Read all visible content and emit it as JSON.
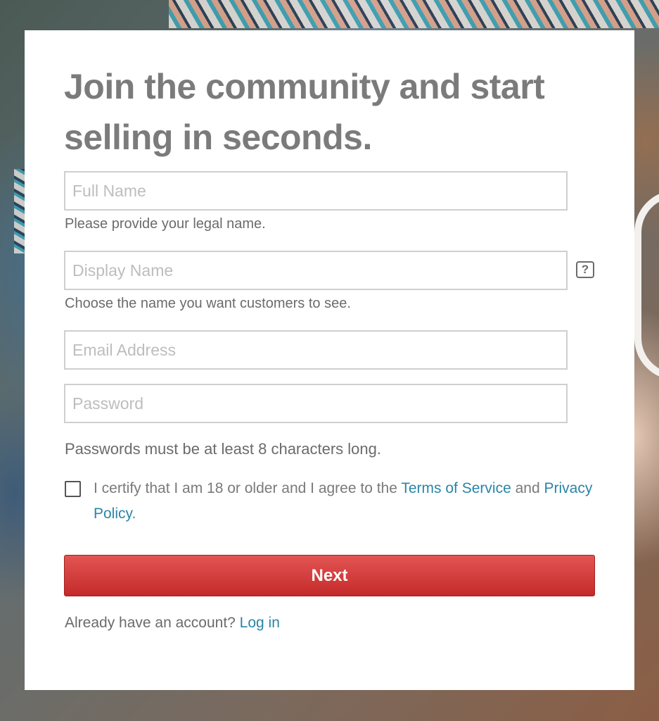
{
  "headline": "Join the community and start selling in seconds.",
  "fields": {
    "full_name": {
      "placeholder": "Full Name",
      "hint": "Please provide your legal name."
    },
    "display_name": {
      "placeholder": "Display Name",
      "hint": "Choose the name you want customers to see.",
      "help_icon": "?"
    },
    "email": {
      "placeholder": "Email Address"
    },
    "password": {
      "placeholder": "Password"
    }
  },
  "password_note": "Passwords must be at least 8 characters long.",
  "terms": {
    "prefix": "I certify that I am 18 or older and I agree to the ",
    "tos_link": "Terms of Service",
    "middle": " and ",
    "privacy_link": "Privacy Policy",
    "suffix": "."
  },
  "next_button": "Next",
  "login": {
    "prompt": "Already have an account? ",
    "link": "Log in"
  },
  "colors": {
    "accent_link": "#2a85a8",
    "button_red": "#c42a2a",
    "headline_gray": "#7b7b7b"
  }
}
